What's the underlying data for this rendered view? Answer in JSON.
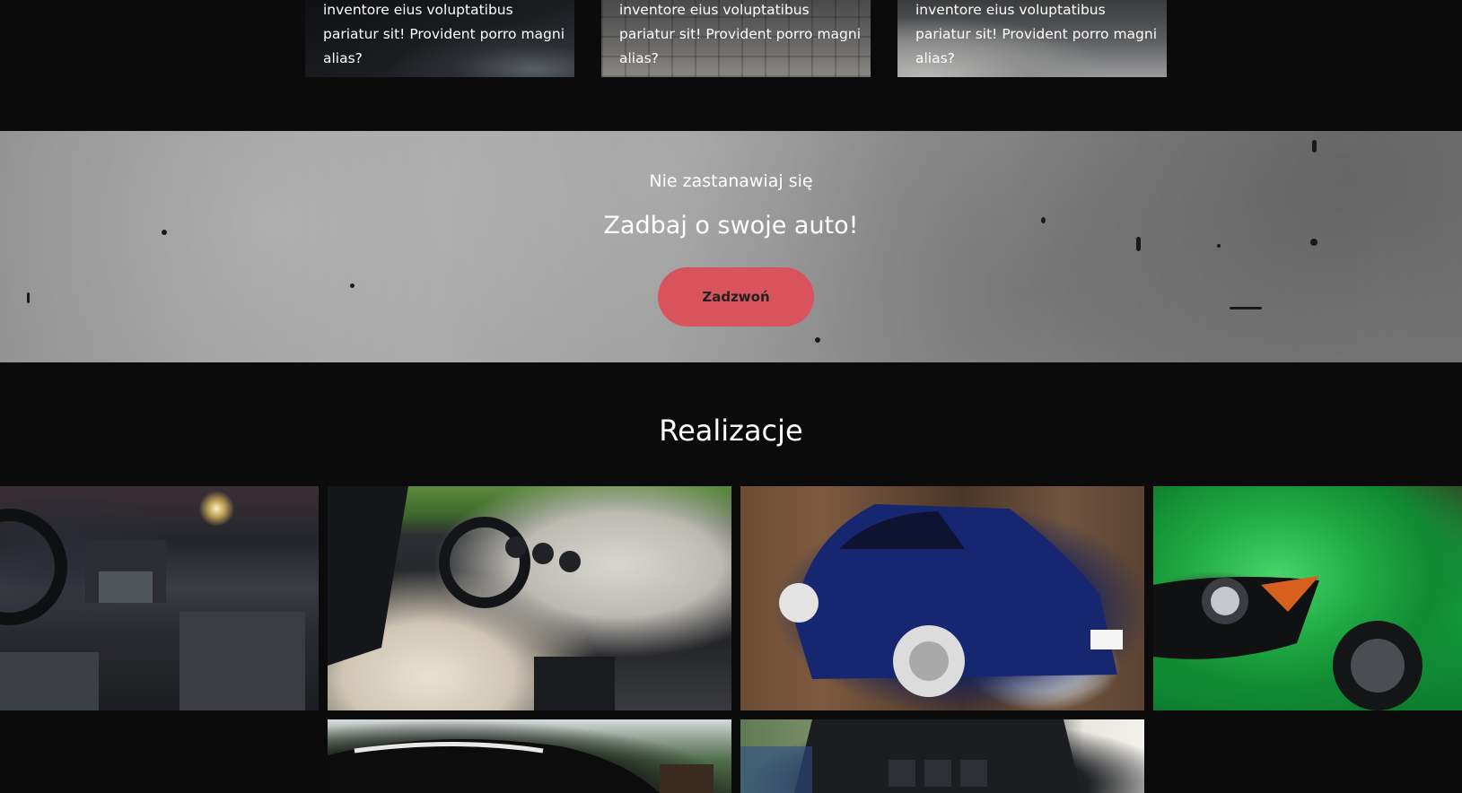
{
  "cards": [
    {
      "text": "inventore eius voluptatibus pariatur sit! Provident porro magni alias?"
    },
    {
      "text": "inventore eius voluptatibus pariatur sit! Provident porro magni alias?"
    },
    {
      "text": "inventore eius voluptatibus pariatur sit! Provident porro magni alias?"
    }
  ],
  "cta": {
    "subtitle": "Nie zastanawiaj się",
    "title": "Zadbaj o swoje auto!",
    "button_label": "Zadzwoń",
    "button_color": "#d9535d"
  },
  "realizacje": {
    "title": "Realizacje",
    "items": [
      {
        "name": "car-interior-bmw"
      },
      {
        "name": "car-interior-mustang"
      },
      {
        "name": "blue-hatchback"
      },
      {
        "name": "green-mustang-front"
      },
      {
        "name": "black-car"
      },
      {
        "name": "suv-trunk"
      }
    ]
  }
}
